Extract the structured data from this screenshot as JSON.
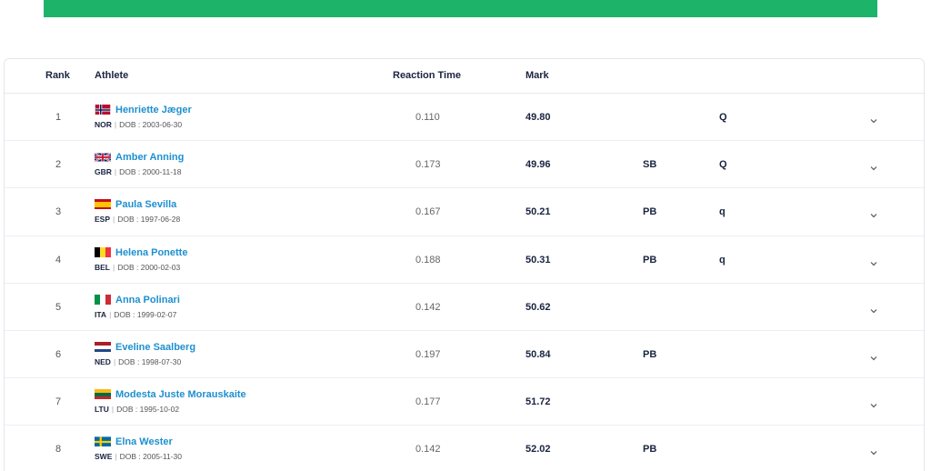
{
  "headers": {
    "rank": "Rank",
    "athlete": "Athlete",
    "reaction": "Reaction Time",
    "mark": "Mark"
  },
  "dob_prefix": "DOB :",
  "rows": [
    {
      "rank": "1",
      "name": "Henriette Jæger",
      "country": "NOR",
      "dob": "2003-06-30",
      "reaction": "0.110",
      "mark": "49.80",
      "record": "",
      "qualifier": "Q",
      "flag": "norway-flag"
    },
    {
      "rank": "2",
      "name": "Amber Anning",
      "country": "GBR",
      "dob": "2000-11-18",
      "reaction": "0.173",
      "mark": "49.96",
      "record": "SB",
      "qualifier": "Q",
      "flag": "uk-flag"
    },
    {
      "rank": "3",
      "name": "Paula Sevilla",
      "country": "ESP",
      "dob": "1997-06-28",
      "reaction": "0.167",
      "mark": "50.21",
      "record": "PB",
      "qualifier": "q",
      "flag": "spain-flag"
    },
    {
      "rank": "4",
      "name": "Helena Ponette",
      "country": "BEL",
      "dob": "2000-02-03",
      "reaction": "0.188",
      "mark": "50.31",
      "record": "PB",
      "qualifier": "q",
      "flag": "belgium-flag"
    },
    {
      "rank": "5",
      "name": "Anna Polinari",
      "country": "ITA",
      "dob": "1999-02-07",
      "reaction": "0.142",
      "mark": "50.62",
      "record": "",
      "qualifier": "",
      "flag": "italy-flag"
    },
    {
      "rank": "6",
      "name": "Eveline Saalberg",
      "country": "NED",
      "dob": "1998-07-30",
      "reaction": "0.197",
      "mark": "50.84",
      "record": "PB",
      "qualifier": "",
      "flag": "netherlands-flag"
    },
    {
      "rank": "7",
      "name": "Modesta Juste Morauskaite",
      "country": "LTU",
      "dob": "1995-10-02",
      "reaction": "0.177",
      "mark": "51.72",
      "record": "",
      "qualifier": "",
      "flag": "lithuania-flag"
    },
    {
      "rank": "8",
      "name": "Elna Wester",
      "country": "SWE",
      "dob": "2005-11-30",
      "reaction": "0.142",
      "mark": "52.02",
      "record": "PB",
      "qualifier": "",
      "flag": "sweden-flag"
    }
  ],
  "colors": {
    "accent_bar": "#1db46a",
    "athlete_link": "#1e8fcf",
    "text_dark": "#1a2340"
  }
}
